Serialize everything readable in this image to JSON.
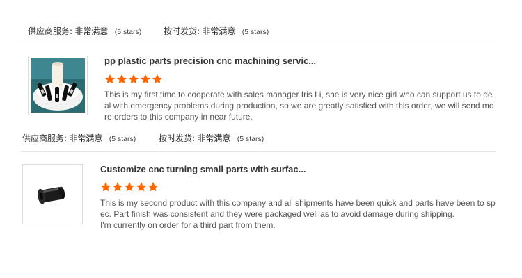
{
  "reviews": [
    {
      "title": "pp plastic parts precision cnc machining servic...",
      "rating_stars": 5,
      "text": "This is my first time to cooperate with sales manager Iris Li, she is very nice girl who can support us to deal with emergency problems during production, so we are greatly satisfied with this order, we will send more orders to this company in near future.",
      "thumbnail": "white-plastic-part-icon"
    },
    {
      "title": "Customize cnc turning small parts with surfac...",
      "rating_stars": 5,
      "text_lines": [
        "This is my second product with this company and all shipments have been quick and parts have been to spec. Part finish was consistent and they were packaged well as to avoid damage during shipping.",
        "I'm currently on order for a third part from them."
      ],
      "thumbnail": "black-turned-part-icon"
    }
  ],
  "ratings_rows": [
    {
      "supplier_label": "供应商服务:",
      "supplier_value": "非常满意",
      "supplier_stars": "(5 stars)",
      "shipping_label": "按时发货:",
      "shipping_value": "非常满意",
      "shipping_stars": "(5 stars)"
    },
    {
      "supplier_label": "供应商服务:",
      "supplier_value": "非常满意",
      "supplier_stars": "(5 stars)",
      "shipping_label": "按时发货:",
      "shipping_value": "非常满意",
      "shipping_stars": "(5 stars)"
    }
  ],
  "colors": {
    "star": "#ff6600",
    "divider": "#e6e6e6"
  }
}
